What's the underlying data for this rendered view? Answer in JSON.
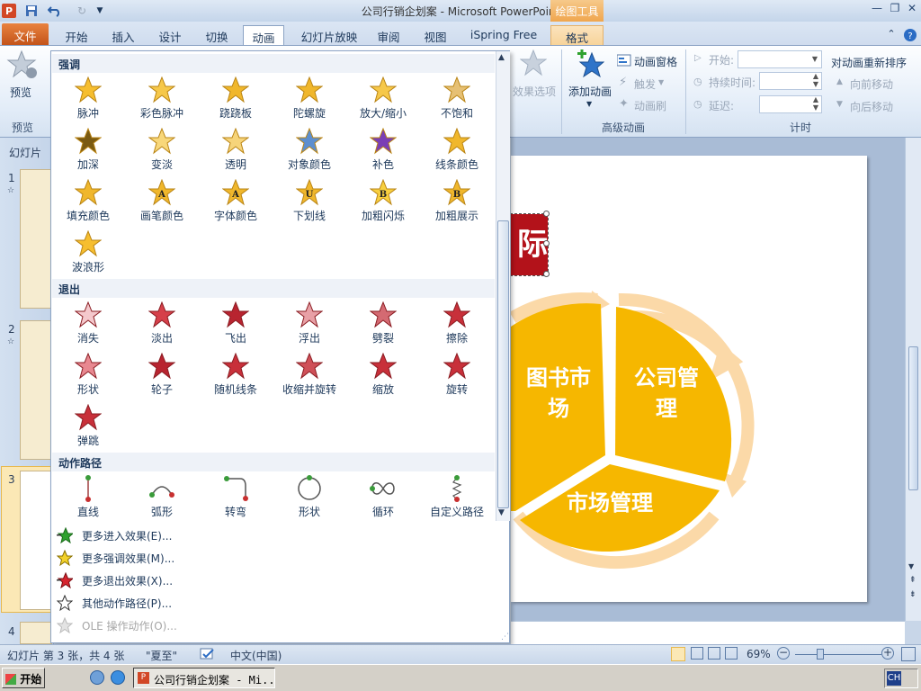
{
  "window": {
    "title": "公司行销企划案 - Microsoft PowerPoint",
    "contextual_tab_group": "绘图工具",
    "app_icon": "P"
  },
  "tabs": [
    "文件",
    "开始",
    "插入",
    "设计",
    "切换",
    "动画",
    "幻灯片放映",
    "审阅",
    "视图",
    "iSpring Free",
    "格式"
  ],
  "ribbon": {
    "preview": {
      "label": "预览",
      "group": "预览"
    },
    "effect_options": "效果选项",
    "add_animation": "添加动画",
    "animation_pane": "动画窗格",
    "trigger": "触发",
    "animation_painter": "动画刷",
    "advanced_group": "高级动画",
    "start_label": "开始:",
    "duration_label": "持续时间:",
    "delay_label": "延迟:",
    "timing_group": "计时",
    "reorder_title": "对动画重新排序",
    "move_earlier": "向前移动",
    "move_later": "向后移动"
  },
  "slides_pane": {
    "header": "幻灯片",
    "numbers": [
      "1",
      "2",
      "3",
      "4"
    ]
  },
  "dropdown": {
    "emphasis_header": "强调",
    "emphasis": [
      "脉冲",
      "彩色脉冲",
      "跷跷板",
      "陀螺旋",
      "放大/缩小",
      "不饱和",
      "加深",
      "变淡",
      "透明",
      "对象颜色",
      "补色",
      "线条颜色",
      "填充颜色",
      "画笔颜色",
      "字体颜色",
      "下划线",
      "加粗闪烁",
      "加粗展示",
      "波浪形"
    ],
    "exit_header": "退出",
    "exit": [
      "消失",
      "淡出",
      "飞出",
      "浮出",
      "劈裂",
      "擦除",
      "形状",
      "轮子",
      "随机线条",
      "收缩并旋转",
      "缩放",
      "旋转",
      "弹跳"
    ],
    "path_header": "动作路径",
    "paths": [
      "直线",
      "弧形",
      "转弯",
      "形状",
      "循环",
      "自定义路径"
    ],
    "more": [
      {
        "label": "更多进入效果(E)...",
        "enabled": true
      },
      {
        "label": "更多强调效果(M)...",
        "enabled": true
      },
      {
        "label": "更多退出效果(X)...",
        "enabled": true
      },
      {
        "label": "其他动作路径(P)...",
        "enabled": true
      },
      {
        "label": "OLE 操作动作(O)...",
        "enabled": false
      }
    ]
  },
  "slide": {
    "red_text": "际",
    "seg_left": "图书市\n场",
    "seg_right": "公司管\n理",
    "seg_bottom": "市场管理"
  },
  "status": {
    "slide_info": "幻灯片 第 3 张，共 4 张",
    "theme": "\"夏至\"",
    "language": "中文(中国)",
    "zoom": "69%"
  },
  "taskbar": {
    "start": "开始",
    "task_item": "公司行销企划案 - Mi...",
    "tray": "CH"
  },
  "colors": {
    "accent_orange": "#f0a800",
    "file_tab": "#d0602a",
    "star_gold": "#f2b630",
    "exit_red": "#c8303a",
    "slide_red": "#b3121a"
  }
}
